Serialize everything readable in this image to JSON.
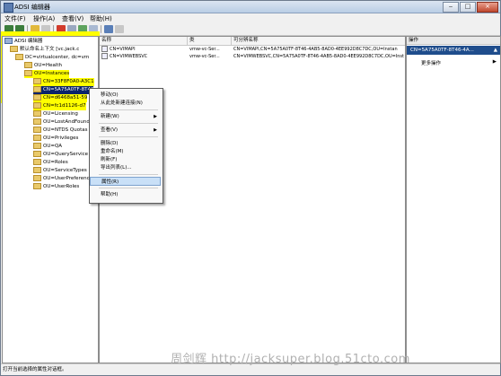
{
  "window": {
    "title": "ADSI 编辑器"
  },
  "menu": [
    "文件(F)",
    "操作(A)",
    "查看(V)",
    "帮助(H)"
  ],
  "tree": {
    "root": "ADSI 编辑器",
    "items": [
      {
        "label": "默认命名上下文 [vc.jack.c"
      },
      {
        "label": "DC=virtualcenter, dc=vm"
      },
      {
        "label": "OU=Health"
      },
      {
        "label": "OU=Instances"
      },
      {
        "label": "CN=33F8F0A0-A3C1"
      },
      {
        "label": "CN=5A75A0TF-8T46",
        "selected": true
      },
      {
        "label": "CN=d6468a51-59"
      },
      {
        "label": "CN=fc1d1126-d7"
      },
      {
        "label": "OU=Licensing"
      },
      {
        "label": "OU=LostAndFound"
      },
      {
        "label": "OU=NTDS Quotas"
      },
      {
        "label": "OU=Privileges"
      },
      {
        "label": "OU=QA"
      },
      {
        "label": "OU=QueryService"
      },
      {
        "label": "OU=Roles"
      },
      {
        "label": "OU=ServiceTypes"
      },
      {
        "label": "OU=UserPreference"
      },
      {
        "label": "OU=UserRoles"
      }
    ]
  },
  "list": {
    "columns": [
      "名称",
      "类",
      "可分辨名称"
    ],
    "rows": [
      {
        "name": "CN=VIMAPI",
        "class": "vmw-vc-Ser...",
        "dn": "CN=VIMAPI,CN=5A75A0TF-8T46-4AB5-8AD0-4EE992D8C7DC,OU=Instan"
      },
      {
        "name": "CN=VIMWEBSVC",
        "class": "vmw-vc-Ser...",
        "dn": "CN=VIMWEBSVC,CN=5A75A0TF-8T46-4AB5-8AD0-4EE992D8C7DC,OU=Insta"
      }
    ]
  },
  "actions": {
    "header": "操作",
    "selected": "CN=5A75A0TF-8T46-4A...",
    "more": "更多操作"
  },
  "context_menu": {
    "items": [
      {
        "label": "移动(O)"
      },
      {
        "label": "从此处新建连接(N)"
      },
      {
        "label": "新建(W)",
        "submenu": true
      },
      {
        "label": "查看(V)",
        "submenu": true
      },
      {
        "label": "删除(D)"
      },
      {
        "label": "重命名(M)"
      },
      {
        "label": "刷新(F)"
      },
      {
        "label": "导出列表(L)..."
      },
      {
        "label": "属性(R)",
        "selected": true
      },
      {
        "label": "帮助(H)"
      }
    ]
  },
  "status": "打开当前选择的属性对话框。",
  "watermark": "周剑辉 http://jacksuper.blog.51cto.com"
}
